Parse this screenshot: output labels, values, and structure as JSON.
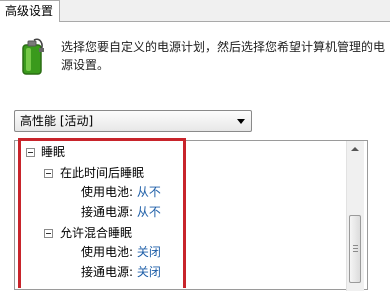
{
  "tabs": {
    "advanced": "高级设置"
  },
  "description": "选择您要自定义的电源计划，然后选择您希望计算机管理的电源设置。",
  "plan_select": {
    "selected": "高性能 [活动]"
  },
  "tree": {
    "sleep": "睡眠",
    "sleep_after": {
      "label": "在此时间后睡眠",
      "battery_label": "使用电池:",
      "battery_value": "从不",
      "plugged_label": "接通电源:",
      "plugged_value": "从不"
    },
    "hybrid_sleep": {
      "label": "允许混合睡眠",
      "battery_label": "使用电池:",
      "battery_value": "关闭",
      "plugged_label": "接通电源:",
      "plugged_value": "关闭"
    }
  },
  "colors": {
    "value_link": "#1f5fa8",
    "highlight_border": "#c8242b"
  },
  "icons": {
    "power": "battery-plan-icon"
  }
}
